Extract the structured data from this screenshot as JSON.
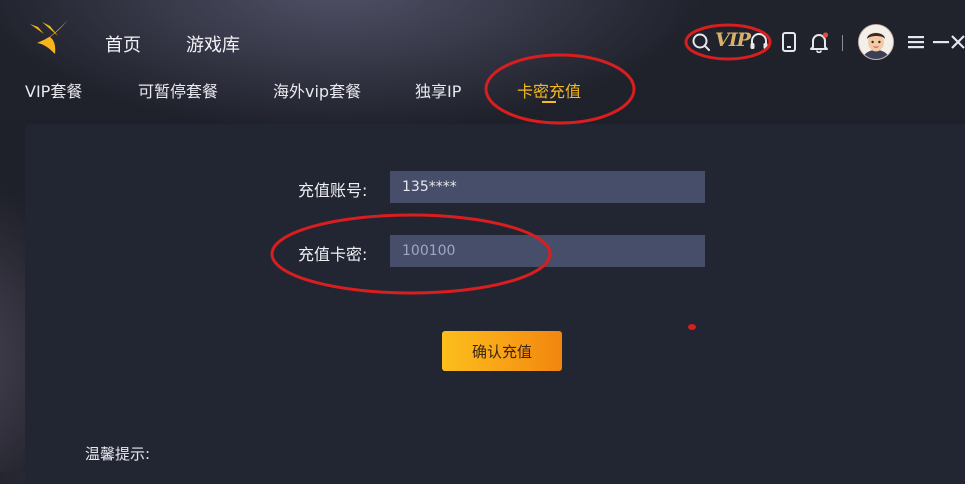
{
  "header": {
    "nav": [
      {
        "label": "首页"
      },
      {
        "label": "游戏库"
      }
    ],
    "vip_badge": "VIP",
    "icons": [
      "logo-icon",
      "search-icon",
      "headset-icon",
      "phone-icon",
      "bell-icon",
      "avatar",
      "menu-icon",
      "minimize-icon",
      "close-icon"
    ],
    "notification_dot_color": "#e34b3b"
  },
  "tabs": [
    {
      "label": "VIP套餐"
    },
    {
      "label": "可暂停套餐"
    },
    {
      "label": "海外vip套餐"
    },
    {
      "label": "独享IP"
    },
    {
      "label": "卡密充值",
      "active": true
    }
  ],
  "form": {
    "account_label": "充值账号:",
    "account_value": "135****",
    "card_label": "充值卡密:",
    "card_value": "100100",
    "confirm_label": "确认充值"
  },
  "tips": {
    "title": "温馨提示:"
  },
  "colors": {
    "accent": "#f5b921",
    "annotation": "#d81e1e",
    "panel": "#222633",
    "input_bg": "#474e6a"
  }
}
